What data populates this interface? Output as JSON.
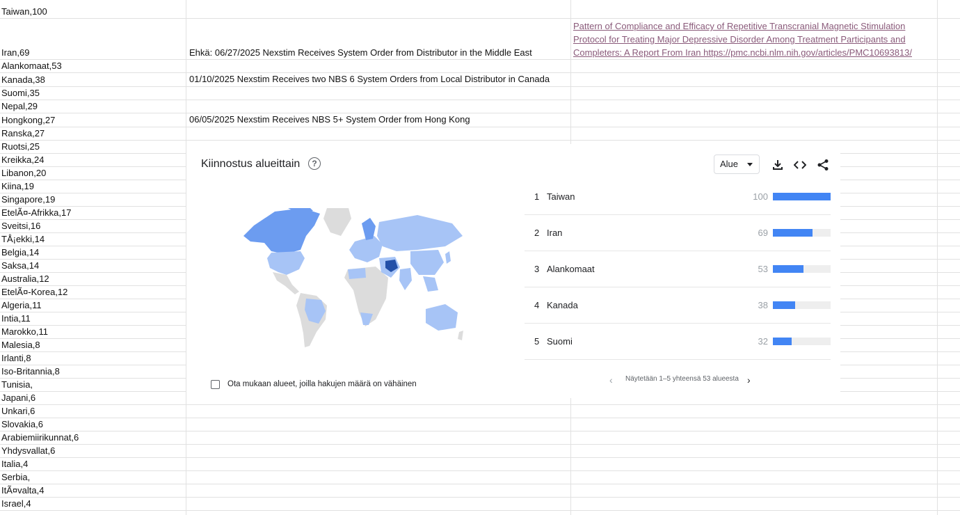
{
  "sheet": {
    "rows": [
      {
        "a": "Taiwan,100",
        "b": "",
        "c": ""
      },
      {
        "a": "Iran,69",
        "b": "Ehkä: 06/27/2025 Nexstim Receives System Order from Distributor in the Middle East",
        "c": "Pattern of Compliance and Efficacy of Repetitive Transcranial Magnetic Stimulation Protocol for Treating Major Depressive Disorder Among Treatment Participants and Completers: A Report From Iran https://pmc.ncbi.nlm.nih.gov/articles/PMC10693813/"
      },
      {
        "a": "Alankomaat,53",
        "b": "",
        "c": ""
      },
      {
        "a": "Kanada,38",
        "b": " 01/10/2025 Nexstim Receives two NBS 6 System Orders from Local Distributor in Canada",
        "c": ""
      },
      {
        "a": "Suomi,35",
        "b": "",
        "c": ""
      },
      {
        "a": "Nepal,29",
        "b": "",
        "c": ""
      },
      {
        "a": "Hongkong,27",
        "b": " 06/05/2025 Nexstim Receives NBS 5+ System Order from Hong Kong",
        "c": ""
      },
      {
        "a": "Ranska,27",
        "b": "",
        "c": ""
      },
      {
        "a": "Ruotsi,25",
        "b": "",
        "c": ""
      },
      {
        "a": "Kreikka,24",
        "b": "",
        "c": ""
      },
      {
        "a": "Libanon,20",
        "b": "",
        "c": ""
      },
      {
        "a": "Kiina,19",
        "b": "",
        "c": ""
      },
      {
        "a": "Singapore,19",
        "b": "",
        "c": ""
      },
      {
        "a": "EtelÃ¤-Afrikka,17",
        "b": "",
        "c": ""
      },
      {
        "a": "Sveitsi,16",
        "b": "",
        "c": ""
      },
      {
        "a": "TÅ¡ekki,14",
        "b": "",
        "c": ""
      },
      {
        "a": "Belgia,14",
        "b": "",
        "c": ""
      },
      {
        "a": "Saksa,14",
        "b": "",
        "c": ""
      },
      {
        "a": "Australia,12",
        "b": "",
        "c": ""
      },
      {
        "a": "EtelÃ¤-Korea,12",
        "b": "",
        "c": ""
      },
      {
        "a": "Algeria,11",
        "b": "",
        "c": ""
      },
      {
        "a": "Intia,11",
        "b": "",
        "c": ""
      },
      {
        "a": "Marokko,11",
        "b": "",
        "c": ""
      },
      {
        "a": "Malesia,8",
        "b": "",
        "c": ""
      },
      {
        "a": "Irlanti,8",
        "b": "",
        "c": ""
      },
      {
        "a": "Iso-Britannia,8",
        "b": "",
        "c": ""
      },
      {
        "a": "Tunisia,",
        "b": "",
        "c": ""
      },
      {
        "a": "Japani,6",
        "b": "",
        "c": ""
      },
      {
        "a": "Unkari,6",
        "b": "",
        "c": ""
      },
      {
        "a": "Slovakia,6",
        "b": "",
        "c": ""
      },
      {
        "a": "Arabiemiirikunnat,6",
        "b": "",
        "c": ""
      },
      {
        "a": "Yhdysvallat,6",
        "b": "",
        "c": ""
      },
      {
        "a": "Italia,4",
        "b": "",
        "c": ""
      },
      {
        "a": "Serbia,",
        "b": "",
        "c": ""
      },
      {
        "a": "ItÃ¤valta,4",
        "b": "",
        "c": ""
      },
      {
        "a": "Israel,4",
        "b": "",
        "c": ""
      }
    ]
  },
  "widget": {
    "title": "Kiinnostus alueittain",
    "help_symbol": "?",
    "select_value": "Alue",
    "icons": [
      "download-icon",
      "embed-code-icon",
      "share-icon"
    ],
    "checkbox_label": "Ota mukaan alueet, joilla hakujen määrä on vähäinen",
    "pager_text": "Näytetään 1–5 yhteensä 53 alueesta",
    "bar_color": "#4285f4",
    "ranking": [
      {
        "rank": "1",
        "name": "Taiwan",
        "value": 100
      },
      {
        "rank": "2",
        "name": "Iran",
        "value": 69
      },
      {
        "rank": "3",
        "name": "Alankomaat",
        "value": 53
      },
      {
        "rank": "4",
        "name": "Kanada",
        "value": 38
      },
      {
        "rank": "5",
        "name": "Suomi",
        "value": 32
      }
    ]
  }
}
